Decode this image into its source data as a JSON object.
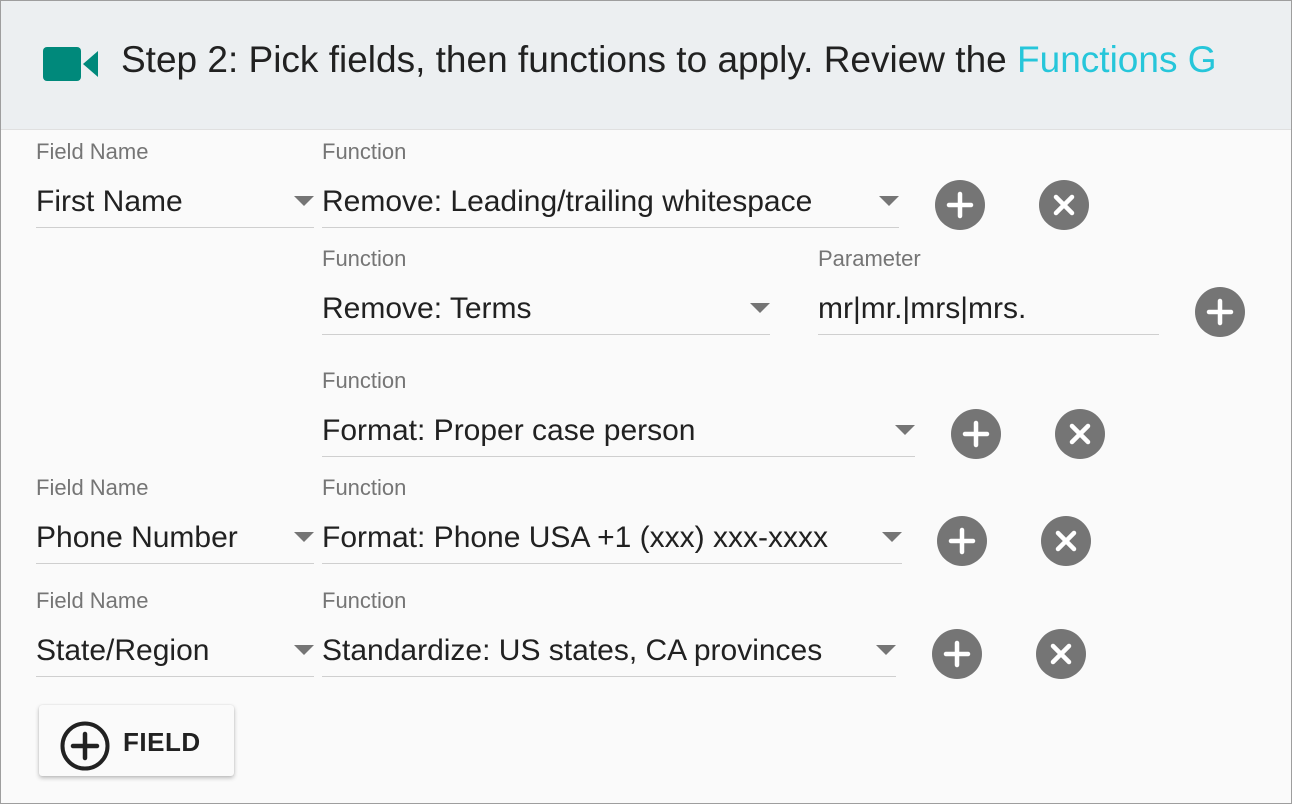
{
  "header": {
    "icon": "video-camera-icon",
    "accent": "#00897b",
    "text": "Step 2: Pick fields, then functions to apply. Review the ",
    "link_text": "Functions G",
    "link_color": "#26c6da"
  },
  "labels": {
    "field_name": "Field Name",
    "function": "Function",
    "parameter": "Parameter"
  },
  "rows": [
    {
      "field": "First Name",
      "function": "Remove: Leading/trailing whitespace"
    },
    {
      "function": "Remove: Terms",
      "parameter": "mr|mr.|mrs|mrs."
    },
    {
      "function": "Format: Proper case person"
    },
    {
      "field": "Phone Number",
      "function": "Format: Phone USA +1 (xxx) xxx-xxxx"
    },
    {
      "field": "State/Region",
      "function": "Standardize: US states, CA provinces"
    }
  ],
  "add_field_button": {
    "label": "FIELD",
    "icon": "add-circle-outline-icon"
  }
}
